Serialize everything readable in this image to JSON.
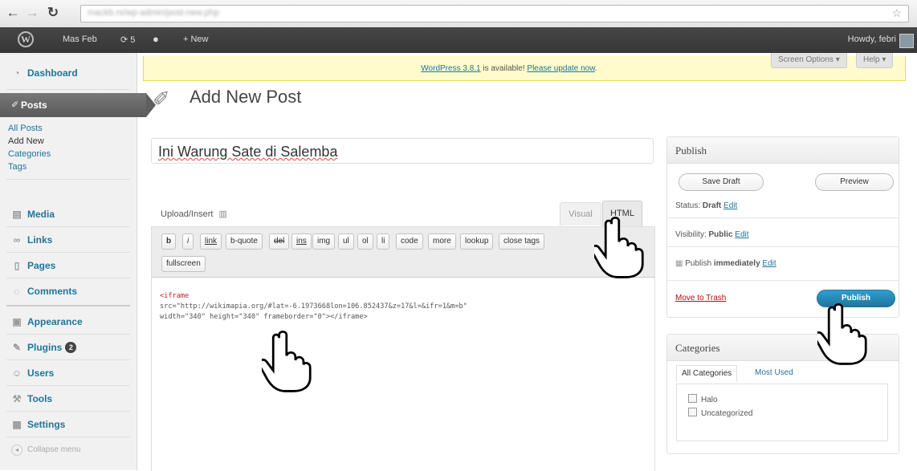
{
  "browser": {
    "back_glyph": "←",
    "forward_glyph": "→",
    "reload_glyph": "↻",
    "url": "mackb.rs/wp-admin/post-new.php",
    "star_glyph": "☆"
  },
  "admin_bar": {
    "site_name": "Mas Feb",
    "updates_count": "5",
    "new_label": "+ New",
    "howdy": "Howdy, febri"
  },
  "sidebar": {
    "dashboard": "Dashboard",
    "posts": "Posts",
    "sub": {
      "all_posts": "All Posts",
      "add_new": "Add New",
      "categories": "Categories",
      "tags": "Tags"
    },
    "media": "Media",
    "links": "Links",
    "pages": "Pages",
    "comments": "Comments",
    "appearance": "Appearance",
    "plugins": "Plugins",
    "plugins_badge": "2",
    "users": "Users",
    "tools": "Tools",
    "settings": "Settings",
    "collapse": "Collapse menu"
  },
  "notice": {
    "link1": "WordPress 3.8.1",
    "text": " is available! ",
    "link2": "Please update now",
    "end": "."
  },
  "screen_options": {
    "screen_options_label": "Screen Options ▾",
    "help_label": "Help ▾"
  },
  "page": {
    "title": "Add New Post",
    "post_title_value": "Ini Warung Sate di Salemba"
  },
  "editor": {
    "upload_label": "Upload/Insert",
    "visual_tab": "Visual",
    "html_tab": "HTML",
    "buttons": [
      "b",
      "i",
      "link",
      "b-quote",
      "del",
      "ins",
      "img",
      "ul",
      "ol",
      "li",
      "code",
      "more",
      "lookup",
      "close tags"
    ],
    "fullscreen": "fullscreen",
    "code_line1": "<iframe",
    "code_line2": "src=\"http://wikimapia.org/#lat=-6.1973668lon=106.852437&z=17&l=&ifr=1&m=b\"",
    "code_line3": "width=\"340\" height=\"340\" frameborder=\"0\"></iframe>"
  },
  "publish": {
    "heading": "Publish",
    "save_draft": "Save Draft",
    "preview": "Preview",
    "status_label": "Status:",
    "status_value": "Draft",
    "visibility_label": "Visibility:",
    "visibility_value": "Public",
    "publish_label": "Publish",
    "publish_value": "immediately",
    "edit": "Edit",
    "move_to_trash": "Move to Trash",
    "publish_button": "Publish"
  },
  "categories": {
    "heading": "Categories",
    "tab_all": "All Categories",
    "tab_most": "Most Used",
    "items": [
      "Halo",
      "Uncategorized"
    ]
  },
  "colors": {
    "link": "#21759b",
    "admin_bar": "#464646",
    "notice_bg": "#fffbcc",
    "publish_button": "#21759b"
  }
}
